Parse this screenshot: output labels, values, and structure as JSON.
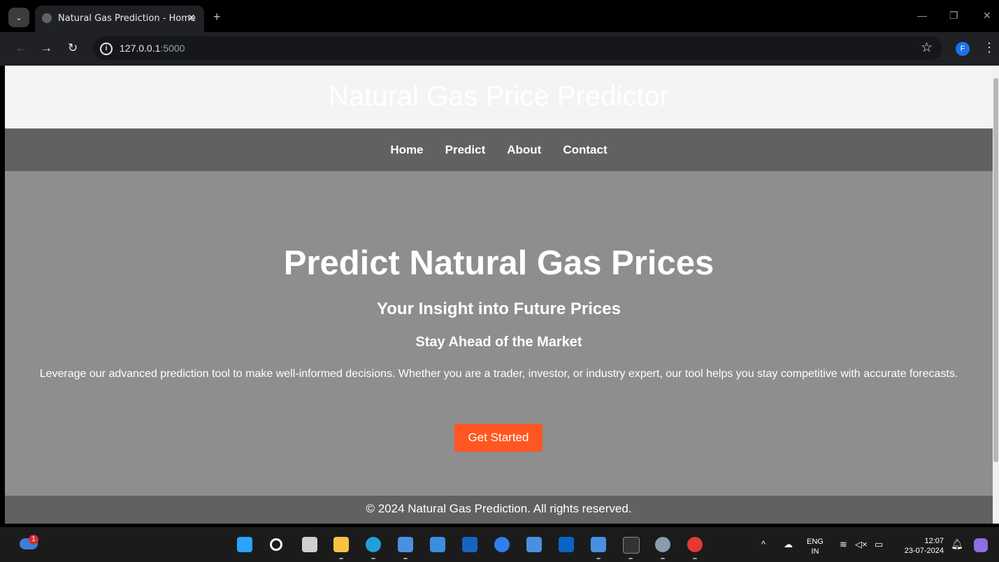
{
  "browser": {
    "tab_title": "Natural Gas Prediction - Home",
    "tab_close": "✕",
    "new_tab": "+",
    "url_host": "127.0.0.1",
    "url_port": ":5000",
    "profile_initial": "F"
  },
  "site": {
    "title": "Natural Gas Price Predictor",
    "nav": [
      "Home",
      "Predict",
      "About",
      "Contact"
    ],
    "hero": {
      "heading": "Predict Natural Gas Prices",
      "subheading": "Your Insight into Future Prices",
      "tagline": "Stay Ahead of the Market",
      "description": "Leverage our advanced prediction tool to make well-informed decisions. Whether you are a trader, investor, or industry expert, our tool helps you stay competitive with accurate forecasts.",
      "cta_label": "Get Started"
    },
    "footer": "© 2024 Natural Gas Prediction. All rights reserved."
  },
  "taskbar": {
    "weather_badge": "1",
    "language": "ENG",
    "region": "IN",
    "time": "12:07",
    "date": "23-07-2024",
    "icons": [
      "start-icon",
      "search-icon",
      "task-view-icon",
      "file-explorer-icon",
      "edge-icon",
      "app-icon",
      "store-icon",
      "myhp-icon",
      "help-icon",
      "app2-icon",
      "outlook-icon",
      "app3-icon",
      "terminal-icon",
      "settings-icon",
      "chrome-icon"
    ]
  },
  "colors": {
    "nav_bg": "#616161",
    "hero_bg": "#8e8e8e",
    "cta_bg": "#ff5722",
    "footer_bg": "#616161"
  }
}
